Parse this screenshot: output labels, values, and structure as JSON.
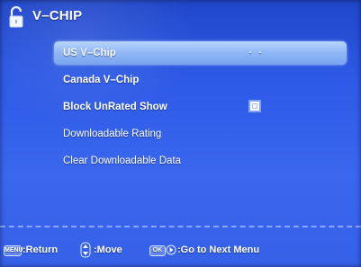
{
  "header": {
    "title": "V–CHIP",
    "icon": "lock-icon"
  },
  "menu": {
    "items": [
      {
        "label": "US V–Chip",
        "selected": true,
        "trailing": "· ·"
      },
      {
        "label": "Canada V–Chip"
      },
      {
        "label": "Block UnRated Show",
        "checkbox_checked": false
      },
      {
        "label": "Downloadable Rating"
      },
      {
        "label": "Clear Downloadable Data"
      }
    ]
  },
  "footer": {
    "return_key": "MENU",
    "return_label": ":Return",
    "move_label": ":Move",
    "ok_key": "OK",
    "next_label": ":Go to Next Menu"
  },
  "colors": {
    "background": "#2d5ae6",
    "highlight": "#8fb6f5",
    "text": "#ffffff"
  }
}
